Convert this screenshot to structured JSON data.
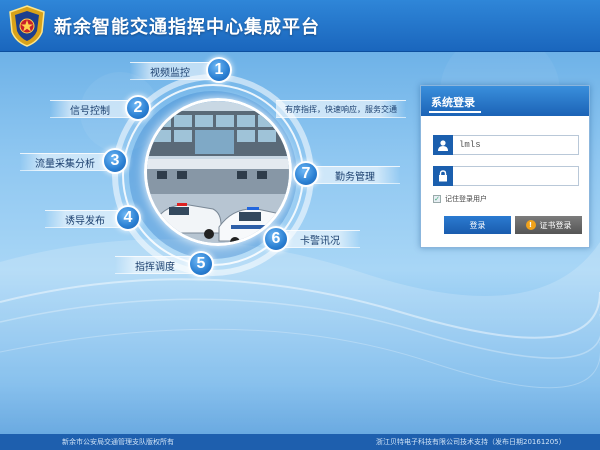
{
  "header": {
    "title": "新余智能交通指挥中心集成平台"
  },
  "menu": [
    {
      "num": "1",
      "label": "视频监控"
    },
    {
      "num": "2",
      "label": "信号控制"
    },
    {
      "num": "3",
      "label": "流量采集分析"
    },
    {
      "num": "4",
      "label": "诱导发布"
    },
    {
      "num": "5",
      "label": "指挥调度"
    },
    {
      "num": "6",
      "label": "卡警讯况"
    },
    {
      "num": "7",
      "label": "勤务管理"
    }
  ],
  "slogan": "有序指挥，快速响应，服务交通",
  "login": {
    "title": "系统登录",
    "username_value": "lmls",
    "password_value": "",
    "remember_label": "记住登录用户",
    "remember_checked": true,
    "login_button": "登录",
    "cert_login_button": "证书登录"
  },
  "footer": {
    "left": "新余市公安局交通管理支队版权所有",
    "right": "浙江贝特电子科技有限公司技术支持（发布日期20161205）"
  },
  "colors": {
    "header_bg": "#1a66bd",
    "accent": "#1b5fae",
    "cert_icon": "#f1a21b",
    "footer_bg": "#1e5fae"
  },
  "icons": {
    "user": "user-icon",
    "lock": "lock-icon",
    "cert": "certificate-icon",
    "badge": "police-badge-icon"
  }
}
